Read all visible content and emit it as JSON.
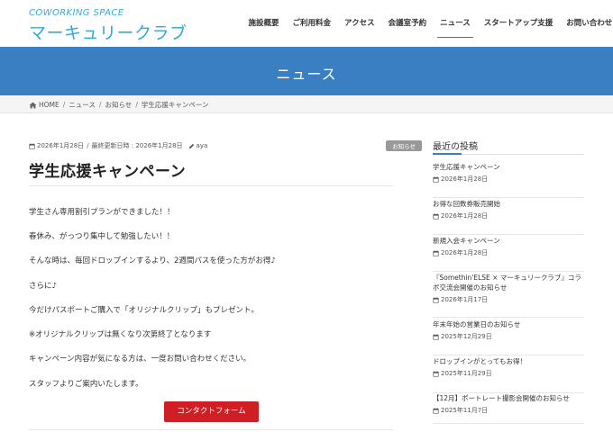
{
  "header": {
    "logo_sub": "COWORKING SPACE",
    "logo_main": "マーキュリークラブ",
    "nav": [
      {
        "label": "施設概要"
      },
      {
        "label": "ご利用料金"
      },
      {
        "label": "アクセス"
      },
      {
        "label": "会議室予約"
      },
      {
        "label": "ニュース",
        "active": true
      },
      {
        "label": "スタートアップ支援"
      },
      {
        "label": "お問い合わせ"
      }
    ]
  },
  "banner": {
    "title": "ニュース"
  },
  "breadcrumb": [
    "HOME",
    "ニュース",
    "お知らせ",
    "学生応援キャンペーン"
  ],
  "post": {
    "date": "2026年1月28日",
    "updated": "最終更新日時 : 2026年1月28日",
    "author": "aya",
    "category": "お知らせ",
    "title": "学生応援キャンペーン",
    "paragraphs": [
      "学生さん専用割引プランができました！！",
      "春休み、がっつり集中して勉強したい！！",
      "そんな時は、毎回ドロップインするより、2週間パスを使った方がお得♪",
      "さらに♪",
      "今だけパスポートご購入で「オリジナルクリップ」もプレゼント。",
      "※オリジナルクリップは無くなり次第終了となります",
      "キャンペーン内容が気になる方は、一度お問い合わせください。",
      "スタッフよりご案内いたします。"
    ],
    "button": "コンタクトフォーム"
  },
  "sidebar": {
    "heading": "最近の投稿",
    "posts": [
      {
        "title": "学生応援キャンペーン",
        "date": "2026年1月28日"
      },
      {
        "title": "お得な回数券販売開始",
        "date": "2026年1月28日"
      },
      {
        "title": "新規入会キャンペーン",
        "date": "2026年1月28日"
      },
      {
        "title": "『Somethin'ELSE × マーキュリークラブ』コラボ交流会開催のお知らせ",
        "date": "2026年1月17日"
      },
      {
        "title": "年末年始の営業日のお知らせ",
        "date": "2025年12月29日"
      },
      {
        "title": "ドロップインがとってもお得！",
        "date": "2025年11月29日"
      },
      {
        "title": "【12月】ポートレート撮影会開催のお知らせ",
        "date": "2025年11月7日"
      }
    ]
  },
  "colors": {
    "brand": "#34a9d8",
    "banner": "#3a7fc1",
    "button": "#cf1f24",
    "badge": "#999999"
  }
}
